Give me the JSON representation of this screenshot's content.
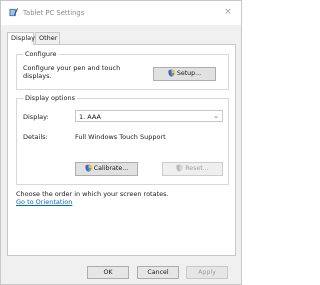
{
  "window": {
    "title": "Tablet PC Settings",
    "close_glyph": "×"
  },
  "tabs": [
    {
      "label": "Display",
      "active": true
    },
    {
      "label": "Other",
      "active": false
    }
  ],
  "configure": {
    "group_label": "Configure",
    "text": "Configure your pen and touch displays.",
    "setup_button": "Setup..."
  },
  "display_options": {
    "group_label": "Display options",
    "display_label": "Display:",
    "display_value": "1. AAA",
    "details_label": "Details:",
    "details_value": "Full Windows Touch Support",
    "calibrate_button": "Calibrate...",
    "reset_button": "Reset..."
  },
  "orientation": {
    "text": "Choose the order in which your screen rotates.",
    "link": "Go to Orientation"
  },
  "footer": {
    "ok": "OK",
    "cancel": "Cancel",
    "apply": "Apply"
  },
  "icons": {
    "app": "tablet-pen-icon",
    "shield": "uac-shield-icon"
  },
  "colors": {
    "link": "#0066cc",
    "window_bg": "#f0f0f0",
    "panel_bg": "#ffffff"
  }
}
